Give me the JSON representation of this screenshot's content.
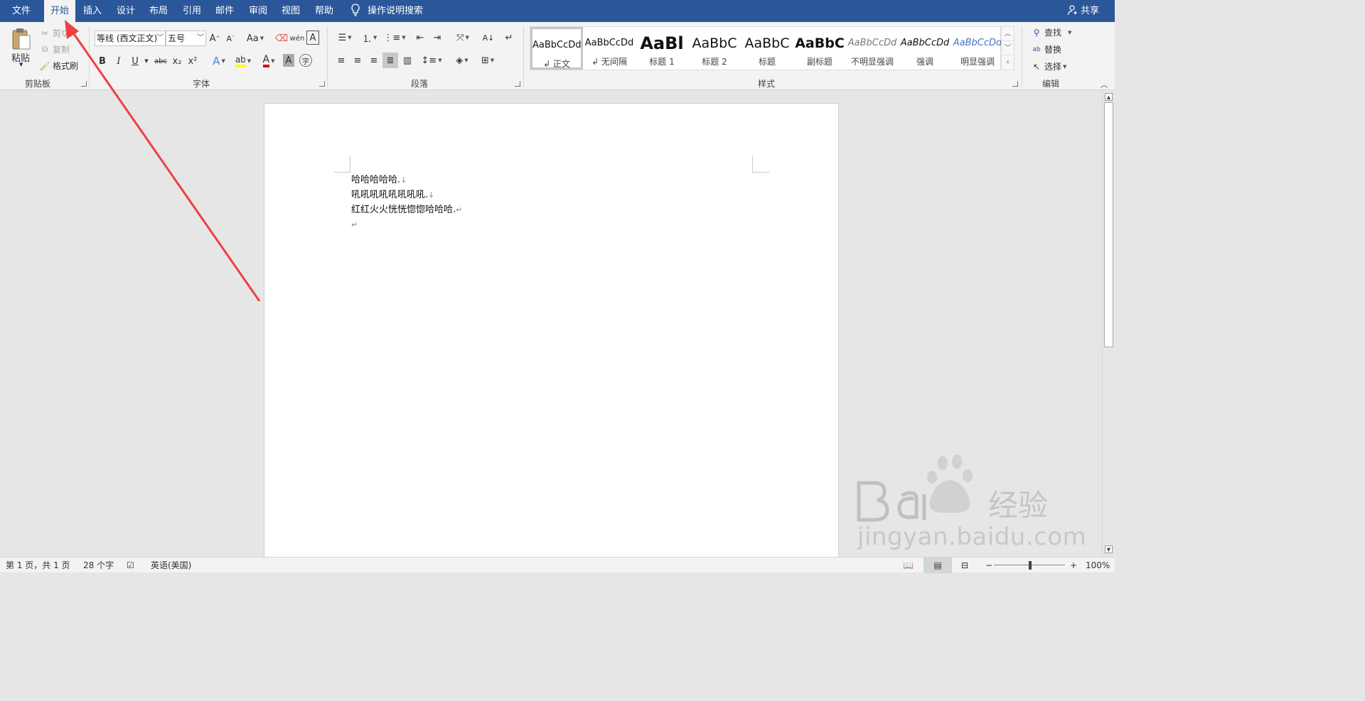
{
  "tabs": [
    "文件",
    "开始",
    "插入",
    "设计",
    "布局",
    "引用",
    "邮件",
    "审阅",
    "视图",
    "帮助"
  ],
  "active_tab": "开始",
  "tell_me": "操作说明搜索",
  "share": "共享",
  "clipboard": {
    "paste": "粘贴",
    "cut": "剪切",
    "copy": "复制",
    "format_painter": "格式刷",
    "label": "剪贴板"
  },
  "font": {
    "font_name": "等线 (西文正文)",
    "font_size": "五号",
    "change_case": "Aa",
    "bold": "B",
    "italic": "I",
    "underline": "U",
    "strike": "abc",
    "subscript": "x₂",
    "superscript": "x²",
    "label": "字体"
  },
  "paragraph": {
    "label": "段落"
  },
  "styles": {
    "label": "样式",
    "items": [
      {
        "sample": "AaBbCcDd",
        "name": "↲ 正文"
      },
      {
        "sample": "AaBbCcDd",
        "name": "↲ 无间隔"
      },
      {
        "sample": "AaBl",
        "name": "标题 1"
      },
      {
        "sample": "AaBbC",
        "name": "标题 2"
      },
      {
        "sample": "AaBbC",
        "name": "标题"
      },
      {
        "sample": "AaBbC",
        "name": "副标题"
      },
      {
        "sample": "AaBbCcDd",
        "name": "不明显强调"
      },
      {
        "sample": "AaBbCcDd",
        "name": "强调"
      },
      {
        "sample": "AaBbCcDd",
        "name": "明显强调"
      }
    ]
  },
  "editing": {
    "find": "查找",
    "replace": "替换",
    "select": "选择",
    "label": "编辑"
  },
  "document": {
    "lines": [
      "哈哈哈哈哈.",
      "吼吼吼吼吼吼吼吼.",
      "红红火火恍恍惚惚哈哈哈."
    ],
    "line_marks": [
      "↓",
      "↓",
      "↵"
    ],
    "empty_mark": "↵"
  },
  "status": {
    "page": "第 1 页，共 1 页",
    "words": "28 个字",
    "language": "英语(美国)",
    "zoom": "100%"
  },
  "watermark": {
    "brand": "Baidu经验",
    "url": "jingyan.baidu.com"
  },
  "annotation_color": "#f04040"
}
